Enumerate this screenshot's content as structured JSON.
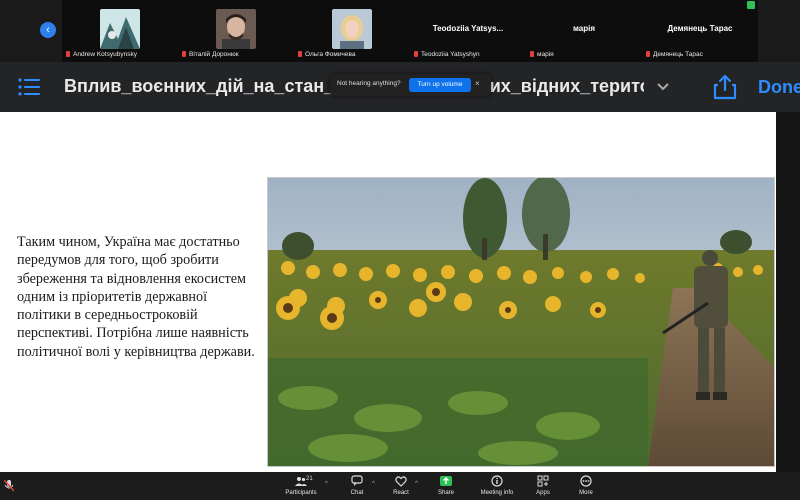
{
  "participants": [
    {
      "name": "Andrew Kotsyubynsky",
      "display": "",
      "type": "photo"
    },
    {
      "name": "Віталій Доронюк",
      "display": "",
      "type": "photo"
    },
    {
      "name": "Ольга Фомичева",
      "display": "",
      "type": "photo"
    },
    {
      "name": "Teodoziia Yatsyshyn",
      "display": "Teodoziia Yatsys...",
      "type": "text"
    },
    {
      "name": "марія",
      "display": "марія",
      "type": "text"
    },
    {
      "name": "Демянець Тарас",
      "display": "Демянець Тарас",
      "type": "text"
    }
  ],
  "header": {
    "title": "Вплив_воєнних_дій_на_стан_прир…_окупованих_відних_терито…",
    "done_label": "Done"
  },
  "toast": {
    "text": "Not hearing anything?",
    "button_label": "Turn up volume",
    "close": "×"
  },
  "slide": {
    "text": "Таким чином, Україна має достатньо передумов для того, щоб зробити збереження та відновлення екосистем одним із пріоритетів державної політики в середньостроковій перспективі. Потрібна лише наявність політичної волі у керівництва держави."
  },
  "toolbar": {
    "participants_label": "Participants",
    "participants_count": "21",
    "chat_label": "Chat",
    "react_label": "React",
    "share_label": "Share",
    "meeting_info_label": "Meeting info",
    "apps_label": "Apps",
    "more_label": "More"
  },
  "colors": {
    "accent": "#2d8cff",
    "share_green": "#2fc05a",
    "muted_red": "#e0423a"
  }
}
